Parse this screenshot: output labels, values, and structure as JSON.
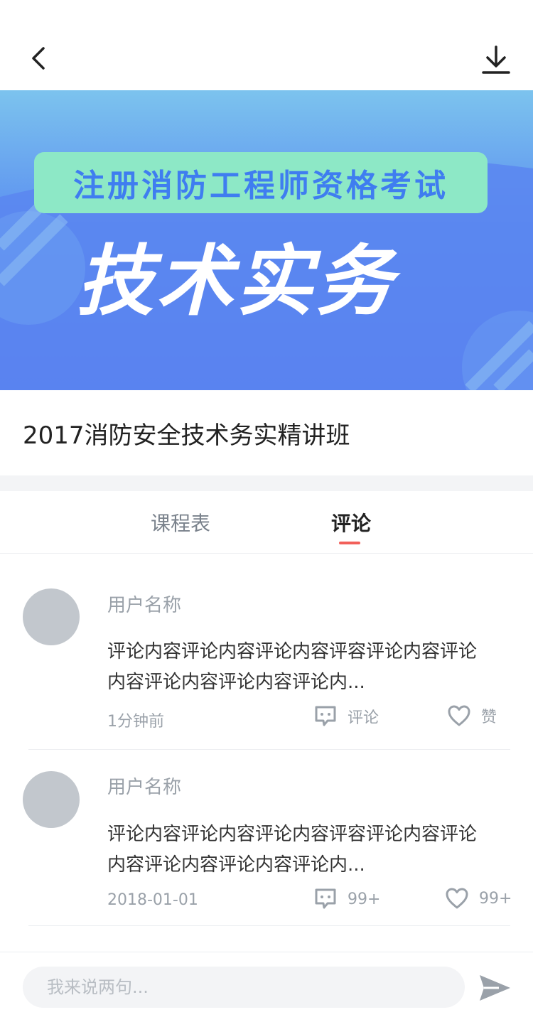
{
  "banner": {
    "subtitle": "注册消防工程师资格考试",
    "headline": "技术实务"
  },
  "course": {
    "title": "2017消防安全技术务实精讲班"
  },
  "tabs": [
    {
      "label": "课程表",
      "active": false
    },
    {
      "label": "评论",
      "active": true
    }
  ],
  "comments": [
    {
      "user": "用户名称",
      "text_line1": "评论内容评论内容评论内容评容评论内容评论",
      "text_line2": "内容评论内容评论内容评论内...",
      "time": "1分钟前",
      "comment_label": "评论",
      "like_label": "赞"
    },
    {
      "user": "用户名称",
      "text_line1": "评论内容评论内容评论内容评容评论内容评论",
      "text_line2": "内容评论内容评论内容评论内...",
      "time": "2018-01-01",
      "comment_label": "99+",
      "like_label": "99+"
    }
  ],
  "composer": {
    "placeholder": "我来说两句..."
  },
  "colors": {
    "accent": "#f2605a",
    "pill": "#8de8c6",
    "pill_text": "#3f7df0",
    "banner_top": "#7cc3ee",
    "banner_bottom": "#5570ee"
  },
  "icons": [
    "back-icon",
    "download-icon",
    "comment-bubble-icon",
    "heart-icon",
    "send-icon"
  ]
}
